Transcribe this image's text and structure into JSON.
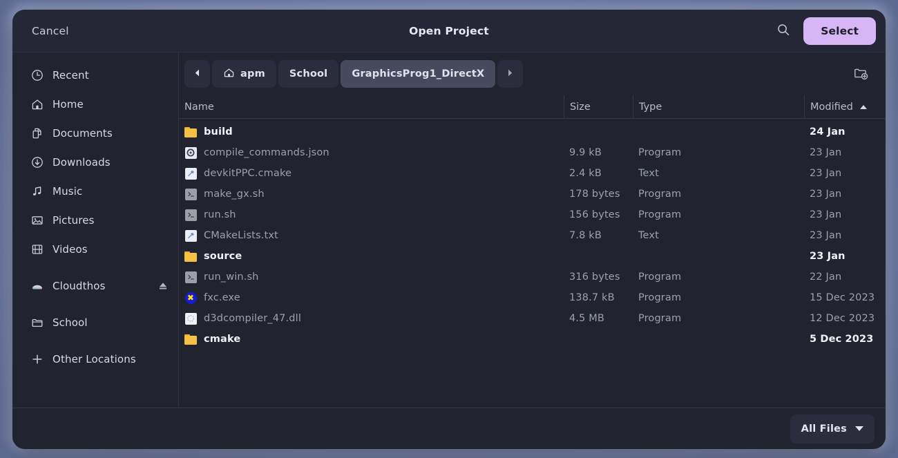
{
  "header": {
    "cancel_label": "Cancel",
    "title": "Open Project",
    "search_icon": "search-icon",
    "select_label": "Select"
  },
  "sidebar": {
    "items": [
      {
        "label": "Recent",
        "icon": "clock-icon"
      },
      {
        "label": "Home",
        "icon": "home-icon"
      },
      {
        "label": "Documents",
        "icon": "documents-icon"
      },
      {
        "label": "Downloads",
        "icon": "download-icon"
      },
      {
        "label": "Music",
        "icon": "music-note-icon"
      },
      {
        "label": "Pictures",
        "icon": "image-icon"
      },
      {
        "label": "Videos",
        "icon": "film-icon"
      },
      {
        "label": "Cloudthos",
        "icon": "drive-icon",
        "eject": "eject-icon"
      },
      {
        "label": "School",
        "icon": "folder-icon"
      },
      {
        "label": "Other Locations",
        "icon": "plus-icon"
      }
    ]
  },
  "pathbar": {
    "back_icon": "chevron-left-icon",
    "forward_icon": "chevron-right-icon",
    "crumbs": [
      {
        "label": "apm",
        "icon": "home-icon",
        "active": false
      },
      {
        "label": "School",
        "icon": "",
        "active": false
      },
      {
        "label": "GraphicsProg1_DirectX",
        "icon": "",
        "active": true
      }
    ],
    "new_folder_icon": "new-folder-icon"
  },
  "columns": {
    "name": "Name",
    "size": "Size",
    "type": "Type",
    "modified": "Modified",
    "sort_direction": "ascending"
  },
  "files": [
    {
      "name": "build",
      "size": "",
      "type": "",
      "modified": "24 Jan",
      "kind": "dir",
      "icon": "folder-icon"
    },
    {
      "name": "compile_commands.json",
      "size": "9.9 kB",
      "type": "Program",
      "modified": "23 Jan",
      "kind": "file",
      "icon": "json-icon"
    },
    {
      "name": "devkitPPC.cmake",
      "size": "2.4 kB",
      "type": "Text",
      "modified": "23 Jan",
      "kind": "file",
      "icon": "cmake-icon"
    },
    {
      "name": "make_gx.sh",
      "size": "178 bytes",
      "type": "Program",
      "modified": "23 Jan",
      "kind": "file",
      "icon": "shell-script-icon"
    },
    {
      "name": "run.sh",
      "size": "156 bytes",
      "type": "Program",
      "modified": "23 Jan",
      "kind": "file",
      "icon": "shell-script-icon"
    },
    {
      "name": "CMakeLists.txt",
      "size": "7.8 kB",
      "type": "Text",
      "modified": "23 Jan",
      "kind": "file",
      "icon": "cmake-icon"
    },
    {
      "name": "source",
      "size": "",
      "type": "",
      "modified": "23 Jan",
      "kind": "dir",
      "icon": "folder-icon"
    },
    {
      "name": "run_win.sh",
      "size": "316 bytes",
      "type": "Program",
      "modified": "22 Jan",
      "kind": "file",
      "icon": "shell-script-icon"
    },
    {
      "name": "fxc.exe",
      "size": "138.7 kB",
      "type": "Program",
      "modified": "15 Dec 2023",
      "kind": "file",
      "icon": "wine-exe-icon"
    },
    {
      "name": "d3dcompiler_47.dll",
      "size": "4.5 MB",
      "type": "Program",
      "modified": "12 Dec 2023",
      "kind": "file",
      "icon": "dll-icon"
    },
    {
      "name": "cmake",
      "size": "",
      "type": "",
      "modified": "5 Dec 2023",
      "kind": "dir",
      "icon": "folder-icon"
    }
  ],
  "footer": {
    "filter_label": "All Files",
    "filter_chevron": "chevron-down-icon"
  },
  "colors": {
    "accent": "#d6b6f5",
    "window_bg": "#21232f",
    "header_bg": "#252736",
    "folder": "#f5c043",
    "text_primary": "#f2f3f9",
    "text_secondary": "#9da0b0"
  }
}
